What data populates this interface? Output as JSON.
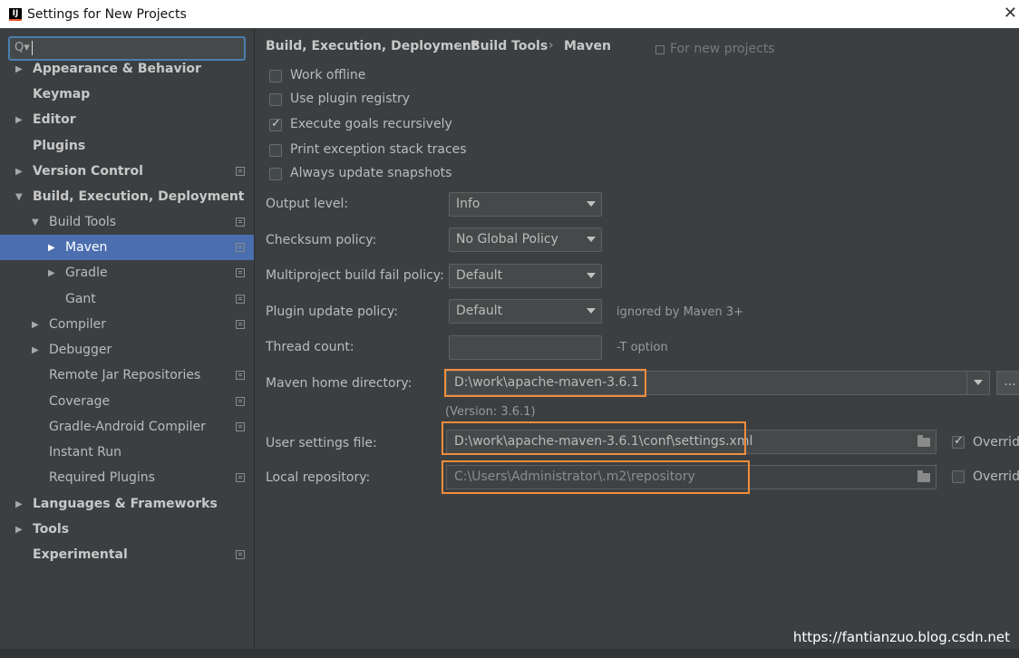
{
  "window": {
    "title": "Settings for New Projects",
    "app_logo": "IJ",
    "close_glyph": "✕"
  },
  "search": {
    "glyph": "Q▾"
  },
  "sidebar": {
    "items": [
      {
        "label": "Appearance & Behavior",
        "expanded": false,
        "copy": false
      },
      {
        "label": "Keymap",
        "copy": false
      },
      {
        "label": "Editor",
        "expanded": false,
        "copy": false
      },
      {
        "label": "Plugins",
        "copy": false
      },
      {
        "label": "Version Control",
        "expanded": false,
        "copy": true
      },
      {
        "label": "Build, Execution, Deployment",
        "expanded": true,
        "copy": false
      },
      {
        "label": "Build Tools",
        "expanded": true,
        "copy": true
      },
      {
        "label": "Maven",
        "expanded": false,
        "copy": true,
        "selected": true
      },
      {
        "label": "Gradle",
        "expanded": false,
        "copy": true
      },
      {
        "label": "Gant",
        "copy": true
      },
      {
        "label": "Compiler",
        "expanded": false,
        "copy": true
      },
      {
        "label": "Debugger",
        "expanded": false,
        "copy": false
      },
      {
        "label": "Remote Jar Repositories",
        "copy": true
      },
      {
        "label": "Coverage",
        "copy": true
      },
      {
        "label": "Gradle-Android Compiler",
        "copy": true
      },
      {
        "label": "Instant Run",
        "copy": false
      },
      {
        "label": "Required Plugins",
        "copy": true
      },
      {
        "label": "Languages & Frameworks",
        "expanded": false,
        "copy": false
      },
      {
        "label": "Tools",
        "expanded": false,
        "copy": false
      },
      {
        "label": "Experimental",
        "copy": true
      }
    ]
  },
  "breadcrumb": {
    "items": [
      "Build, Execution, Deployment",
      "Build Tools",
      "Maven"
    ],
    "separator": "›",
    "scope_note": "For new projects"
  },
  "options": [
    {
      "label": "Work offline",
      "checked": false
    },
    {
      "label": "Use plugin registry",
      "checked": false
    },
    {
      "label": "Execute goals recursively",
      "checked": true
    },
    {
      "label": "Print exception stack traces",
      "checked": false
    },
    {
      "label": "Always update snapshots",
      "checked": false
    }
  ],
  "fields": {
    "output_level": {
      "label": "Output level:",
      "value": "Info"
    },
    "checksum_policy": {
      "label": "Checksum policy:",
      "value": "No Global Policy"
    },
    "fail_policy": {
      "label": "Multiproject build fail policy:",
      "value": "Default"
    },
    "plugin_update_policy": {
      "label": "Plugin update policy:",
      "value": "Default",
      "hint": "ignored by Maven 3+"
    },
    "thread_count": {
      "label": "Thread count:",
      "value": "",
      "hint": "-T option"
    },
    "maven_home": {
      "label": "Maven home directory:",
      "value": "D:\\work\\apache-maven-3.6.1",
      "version": "(Version: 3.6.1)",
      "browse": "..."
    },
    "user_settings": {
      "label": "User settings file:",
      "value": "D:\\work\\apache-maven-3.6.1\\conf\\settings.xml",
      "override_label": "Override",
      "override_checked": true
    },
    "local_repository": {
      "label": "Local repository:",
      "value": "C:\\Users\\Administrator\\.m2\\repository",
      "override_label": "Override",
      "override_checked": false
    }
  },
  "watermark": "https://fantianzuo.blog.csdn.net",
  "colors": {
    "accent": "#4b6eaf",
    "highlight": "#f08d3c",
    "background": "#3c3f41"
  }
}
